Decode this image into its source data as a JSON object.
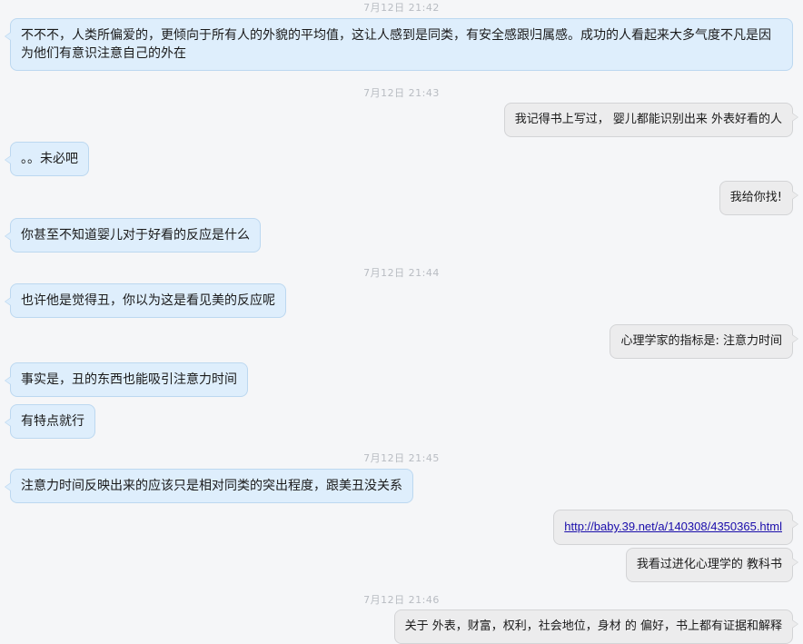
{
  "timestamps": [
    "7月12日  21:42",
    "7月12日  21:43",
    "7月12日  21:44",
    "7月12日  21:45",
    "7月12日  21:46"
  ],
  "messages": [
    {
      "side": "left",
      "text": "不不不，人类所偏爱的，更倾向于所有人的外貌的平均值，这让人感到是同类，有安全感跟归属感。成功的人看起来大多气度不凡是因为他们有意识注意自己的外在"
    },
    {
      "side": "right",
      "text": "我记得书上写过， 婴儿都能识别出来 外表好看的人"
    },
    {
      "side": "left",
      "text": "。。未必吧"
    },
    {
      "side": "right",
      "text": "我给你找!"
    },
    {
      "side": "left",
      "text": "你甚至不知道婴儿对于好看的反应是什么"
    },
    {
      "side": "left",
      "text": "也许他是觉得丑，你以为这是看见美的反应呢"
    },
    {
      "side": "right",
      "text": "心理学家的指标是:  注意力时间"
    },
    {
      "side": "left",
      "text": "事实是，丑的东西也能吸引注意力时间"
    },
    {
      "side": "left",
      "text": "有特点就行"
    },
    {
      "side": "left",
      "text": "注意力时间反映出来的应该只是相对同类的突出程度，跟美丑没关系"
    },
    {
      "side": "right",
      "text": "http://baby.39.net/a/140308/4350365.html"
    },
    {
      "side": "right",
      "text": "我看过进化心理学的 教科书"
    },
    {
      "side": "right",
      "text": "关于 外表，财富，权利，社会地位，身材 的 偏好，书上都有证据和解释"
    }
  ]
}
